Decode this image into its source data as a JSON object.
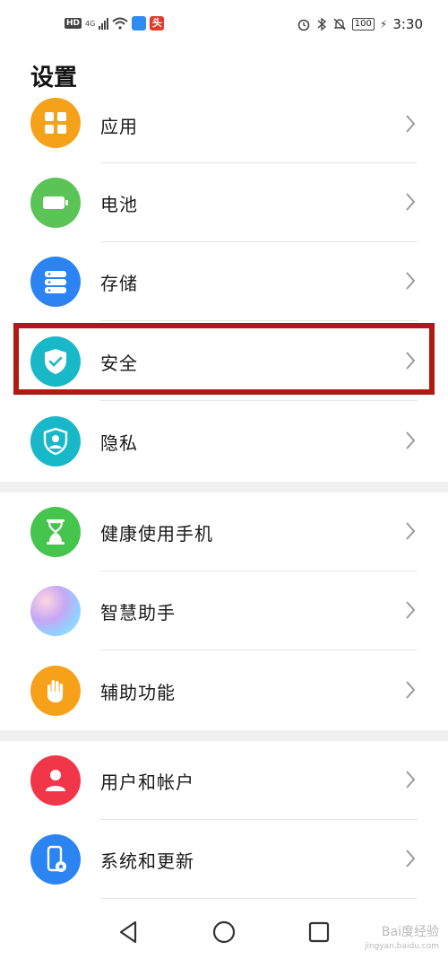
{
  "status_bar": {
    "left": {
      "hd": "HD",
      "network": "4G"
    },
    "right": {
      "battery": "100",
      "time": "3:30"
    }
  },
  "header": {
    "title": "设置"
  },
  "settings_items": [
    {
      "label": "应用",
      "icon": "apps-icon",
      "color": "#f5a21b"
    },
    {
      "label": "电池",
      "icon": "battery-icon",
      "color": "#5bc456"
    },
    {
      "label": "存储",
      "icon": "storage-icon",
      "color": "#2b84f2"
    },
    {
      "label": "安全",
      "icon": "shield-check-icon",
      "color": "#19b8c9"
    },
    {
      "label": "隐私",
      "icon": "privacy-icon",
      "color": "#19b8c9"
    },
    {
      "label": "健康使用手机",
      "icon": "hourglass-icon",
      "color": "#46c54e"
    },
    {
      "label": "智慧助手",
      "icon": "assistant-icon",
      "color": "#b9a1ee"
    },
    {
      "label": "辅助功能",
      "icon": "hand-icon",
      "color": "#f7a11b"
    },
    {
      "label": "用户和帐户",
      "icon": "user-icon",
      "color": "#f2364a"
    },
    {
      "label": "系统和更新",
      "icon": "system-update-icon",
      "color": "#2b84f2"
    }
  ],
  "highlight": {
    "target": "安全",
    "color": "#b01a12"
  },
  "navbar": {
    "items": [
      "back-icon",
      "home-icon",
      "recents-icon"
    ]
  },
  "watermark": {
    "text": "Bai度经验",
    "sub": "jingyan.baidu.com"
  }
}
